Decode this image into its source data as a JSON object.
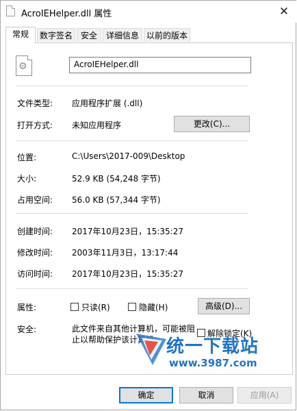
{
  "window": {
    "title": "AcroIEHelper.dll 属性",
    "close_symbol": "✕"
  },
  "tabs": [
    {
      "label": "常规",
      "active": true
    },
    {
      "label": "数字签名",
      "active": false
    },
    {
      "label": "安全",
      "active": false
    },
    {
      "label": "详细信息",
      "active": false
    },
    {
      "label": "以前的版本",
      "active": false
    }
  ],
  "general": {
    "file_name": "AcroIEHelper.dll",
    "file_type_label": "文件类型:",
    "file_type_value": "应用程序扩展 (.dll)",
    "open_with_label": "打开方式:",
    "open_with_value": "未知应用程序",
    "change_button": "更改(C)...",
    "location_label": "位置:",
    "location_value": "C:\\Users\\2017-009\\Desktop",
    "size_label": "大小:",
    "size_value": "52.9 KB (54,248 字节)",
    "size_on_disk_label": "占用空间:",
    "size_on_disk_value": "56.0 KB (57,344 字节)",
    "created_label": "创建时间:",
    "created_value": "2017年10月23日，15:35:27",
    "modified_label": "修改时间:",
    "modified_value": "2003年11月3日，13:17:44",
    "accessed_label": "访问时间:",
    "accessed_value": "2017年10月23日，15:35:27",
    "attributes_label": "属性:",
    "readonly_label": "只读(R)",
    "hidden_label": "隐藏(H)",
    "advanced_button": "高级(D)...",
    "security_label": "安全:",
    "security_text": "此文件来自其他计算机，可能被阻止以帮助保护该计算机。",
    "unblock_label": "解除锁定(K)"
  },
  "footer": {
    "ok": "确定",
    "cancel": "取消",
    "apply": "应用(A)"
  },
  "watermark": {
    "text": "统一下载站",
    "url": "www.3987.com"
  },
  "colors": {
    "accent": "#0078d7",
    "watermark": "#1e74c9"
  }
}
